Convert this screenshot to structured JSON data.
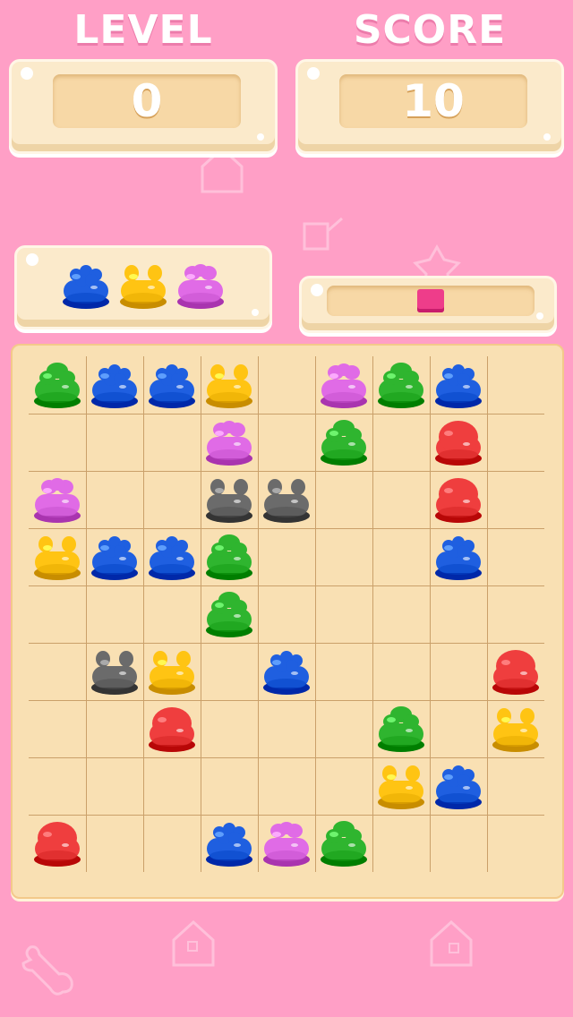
{
  "header": {
    "level_label": "LEVEL",
    "score_label": "SCORE"
  },
  "stats": {
    "level_value": "0",
    "score_value": "10"
  },
  "next_pieces": [
    "blue",
    "yellow",
    "pink"
  ],
  "progress": {
    "fraction": 0.13
  },
  "colors": {
    "red": "#ef3e3e",
    "green": "#2fb52f",
    "blue": "#1f5fe0",
    "yellow": "#ffc413",
    "pink": "#e06be6",
    "gray": "#6b6b6b",
    "background": "#ff9fc6",
    "board": "#f9e0b3"
  },
  "board": {
    "rows": 9,
    "cols": 9,
    "cells": [
      [
        "green",
        "blue",
        "blue",
        "yellow",
        "",
        "pink",
        "green",
        "blue",
        ""
      ],
      [
        "",
        "",
        "",
        "pink",
        "",
        "green",
        "",
        "red",
        ""
      ],
      [
        "pink",
        "",
        "",
        "gray",
        "gray",
        "",
        "",
        "red",
        ""
      ],
      [
        "yellow",
        "blue",
        "blue",
        "green",
        "",
        "",
        "",
        "blue",
        ""
      ],
      [
        "",
        "",
        "",
        "green",
        "",
        "",
        "",
        "",
        ""
      ],
      [
        "",
        "gray",
        "yellow",
        "",
        "blue",
        "",
        "",
        "",
        "red"
      ],
      [
        "",
        "",
        "red",
        "",
        "",
        "",
        "green",
        "",
        "yellow"
      ],
      [
        "",
        "",
        "",
        "",
        "",
        "",
        "yellow",
        "blue",
        ""
      ],
      [
        "red",
        "",
        "",
        "blue",
        "pink",
        "green",
        "",
        "",
        ""
      ]
    ]
  }
}
